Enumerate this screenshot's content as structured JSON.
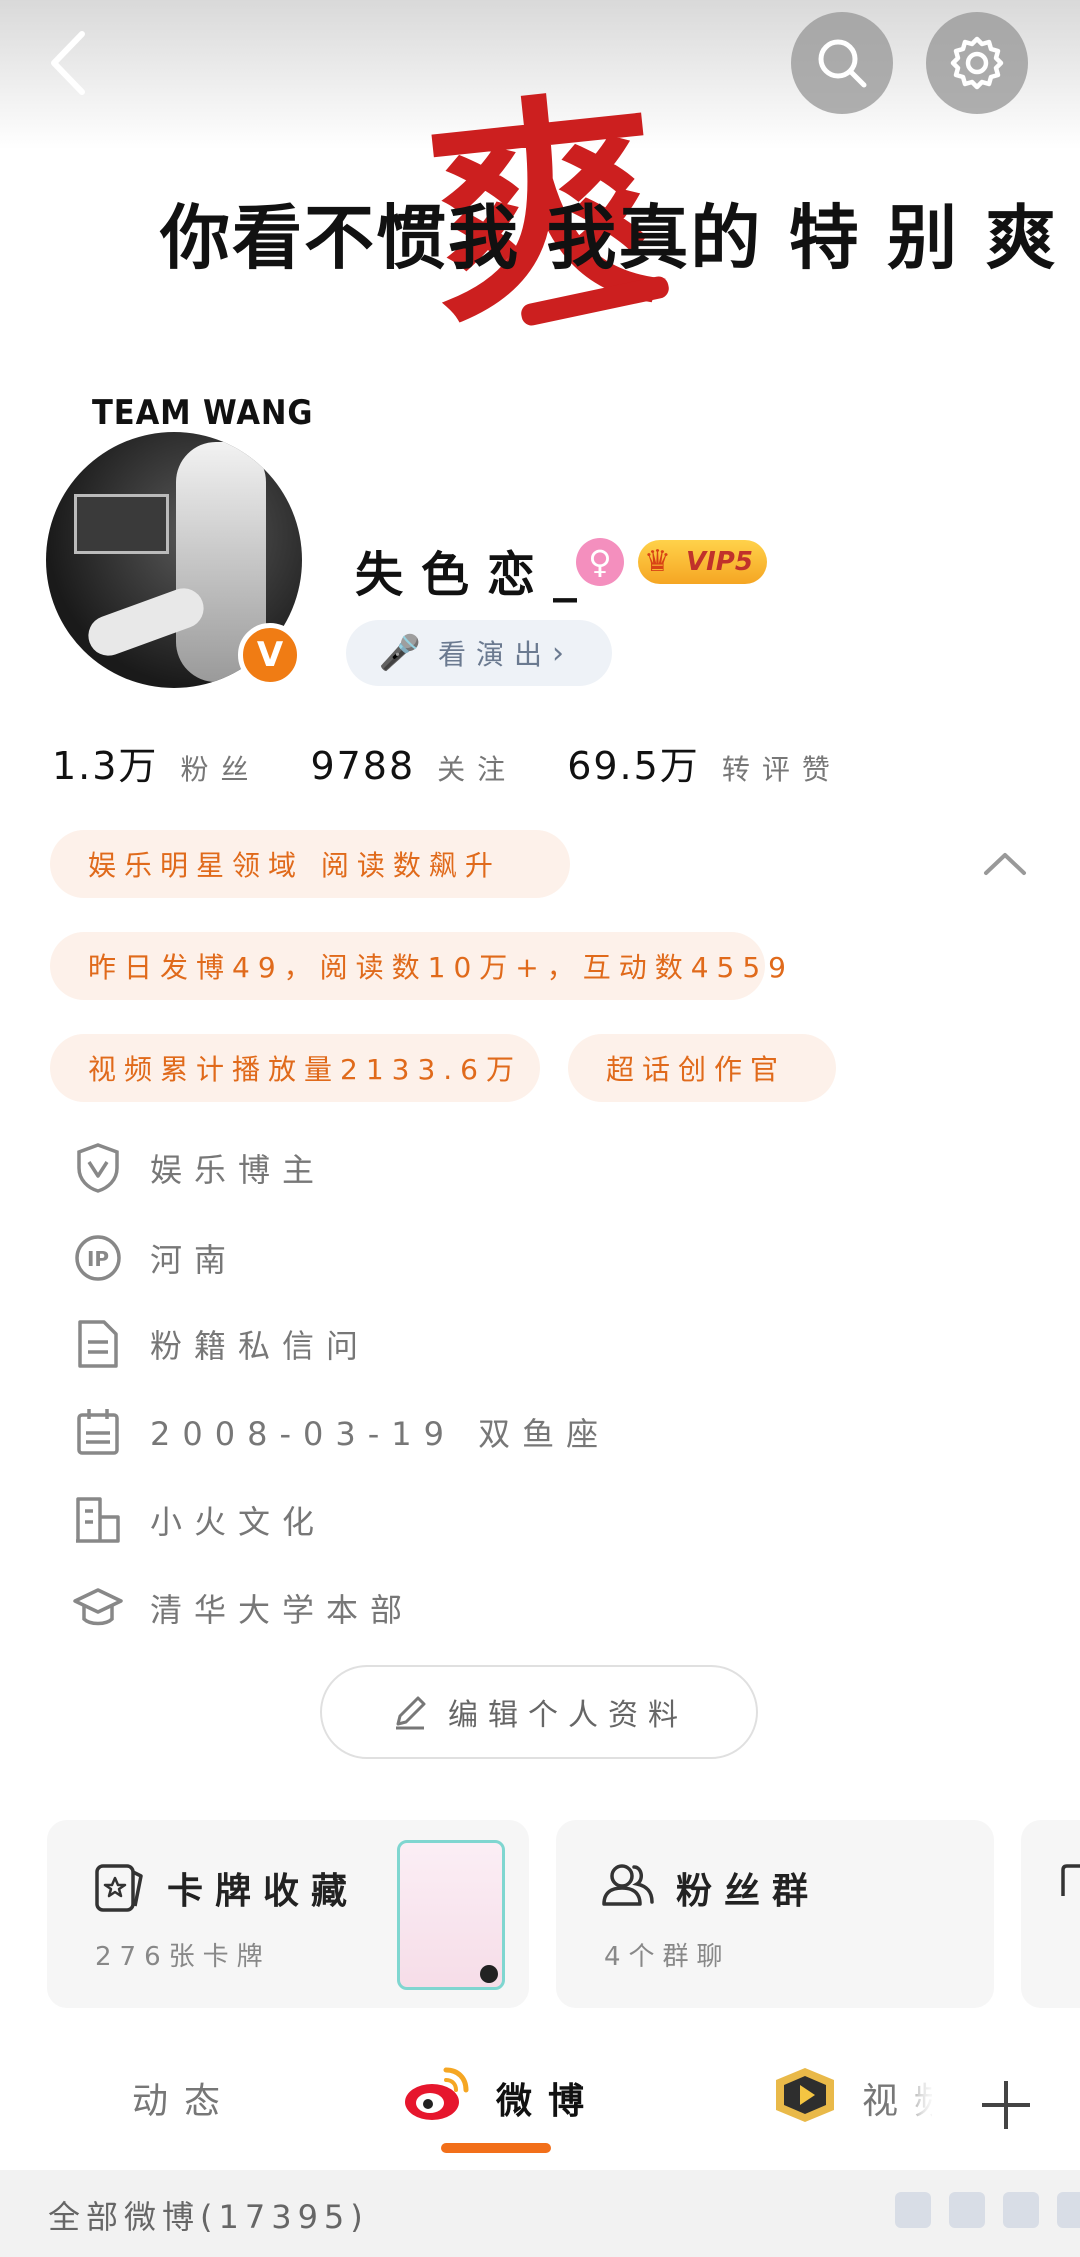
{
  "header": {
    "banner_big_char": "爽",
    "banner_text": "你看不惯我 我真的 特 别 爽",
    "team_label": "TEAM WANG"
  },
  "profile": {
    "username": "失色恋_",
    "verified_mark": "V",
    "gender_symbol": "♀",
    "vip_label": "VIP5",
    "show_pill_label": "看演出"
  },
  "stats": [
    {
      "value": "1.3万",
      "label": "粉丝"
    },
    {
      "value": "9788",
      "label": "关注"
    },
    {
      "value": "69.5万",
      "label": "转评赞"
    }
  ],
  "highlights": {
    "domain": "娱乐明星领域 阅读数飙升",
    "yesterday": "昨日发博49，阅读数10万+，互动数4559",
    "video_plays": "视频累计播放量2133.6万",
    "super_topic": "超话创作官"
  },
  "info": {
    "role": "娱乐博主",
    "ip": "河南",
    "fan_dm": "粉籍私信问",
    "birthday": "2008-03-19 双鱼座",
    "company": "小火文化",
    "school": "清华大学本部"
  },
  "edit_button_label": "编辑个人资料",
  "cards": {
    "card1_title": "卡牌收藏",
    "card1_sub": "276张卡牌",
    "card2_title": "粉丝群",
    "card2_sub": "4个群聊"
  },
  "tabs": {
    "dynamics": "动态",
    "weibo": "微博",
    "video": "视频"
  },
  "feed": {
    "all_weibo": "全部微博(17395)"
  },
  "colors": {
    "accent": "#f26f1a",
    "pill_bg": "#fdf1ea",
    "pill_text": "#e06a1b",
    "banner_red": "#cc1f1f"
  }
}
